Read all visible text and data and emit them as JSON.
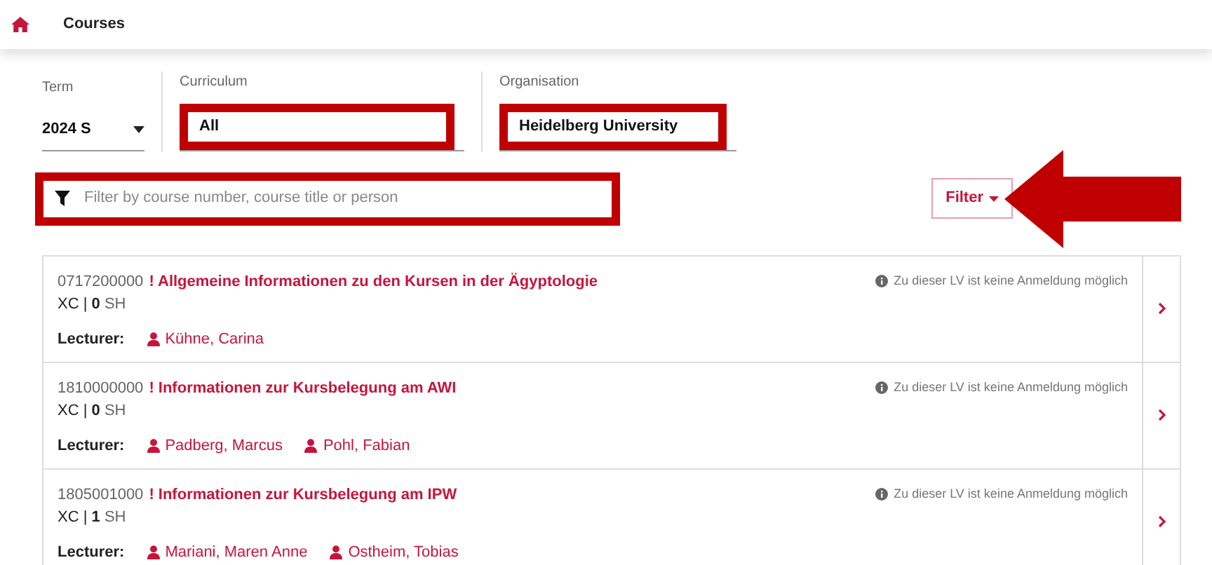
{
  "header": {
    "title": "Courses"
  },
  "filters": [
    {
      "kind": "select",
      "label": "Term",
      "value": "2024 S",
      "highlighted": false
    },
    {
      "kind": "text",
      "label": "Curriculum",
      "value": "All",
      "highlighted": true
    },
    {
      "kind": "text",
      "label": "Organisation",
      "value": "Heidelberg University",
      "highlighted": true
    }
  ],
  "search": {
    "placeholder": "Filter by course number, course title or person",
    "highlighted": true
  },
  "filter_button": {
    "label": "Filter",
    "pointed_at": true
  },
  "courses": [
    {
      "number": "0717200000",
      "title": "! Allgemeine Informationen zu den Kursen in der Ägyptologie",
      "type": "XC",
      "separator": "|",
      "hours": "0",
      "unit": "SH",
      "notice": "Zu dieser LV ist keine Anmeldung möglich",
      "lecturer_label": "Lecturer:",
      "lecturers": [
        "Kühne, Carina"
      ]
    },
    {
      "number": "1810000000",
      "title": "! Informationen zur Kursbelegung am AWI",
      "type": "XC",
      "separator": "|",
      "hours": "0",
      "unit": "SH",
      "notice": "Zu dieser LV ist keine Anmeldung möglich",
      "lecturer_label": "Lecturer:",
      "lecturers": [
        "Padberg, Marcus",
        "Pohl, Fabian"
      ]
    },
    {
      "number": "1805001000",
      "title": "! Informationen zur Kursbelegung am IPW",
      "type": "XC",
      "separator": "|",
      "hours": "1",
      "unit": "SH",
      "notice": "Zu dieser LV ist keine Anmeldung möglich",
      "lecturer_label": "Lecturer:",
      "lecturers": [
        "Mariani, Maren Anne",
        "Ostheim, Tobias"
      ]
    }
  ]
}
